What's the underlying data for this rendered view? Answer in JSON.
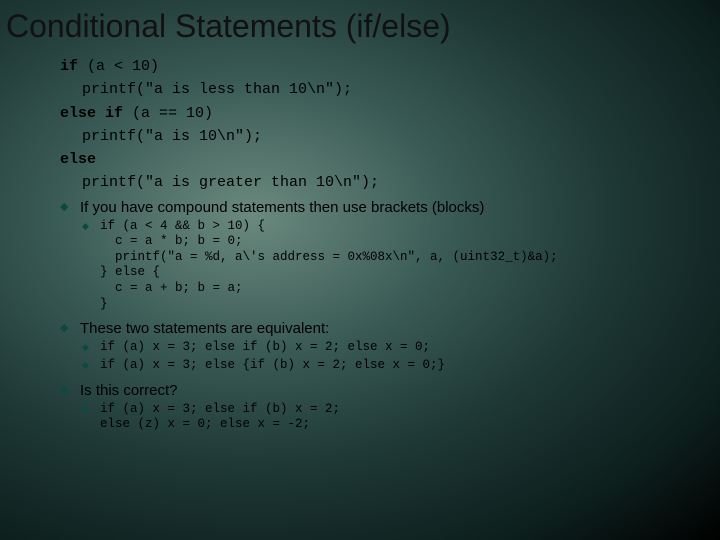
{
  "title": "Conditional Statements (if/else)",
  "code1": {
    "l1a": "if",
    "l1b": " (a < 10)",
    "l2": "printf(\"a is less than 10\\n\");",
    "l3a": "else if",
    "l3b": " (a == 10)",
    "l4": "printf(\"a is 10\\n\");",
    "l5": "else",
    "l6": "printf(\"a is greater than 10\\n\");"
  },
  "bullet1": "If you have compound statements then use brackets (blocks)",
  "block1": "if (a < 4 && b > 10) {\n  c = a * b; b = 0;\n  printf(\"a = %d, a\\'s address = 0x%08x\\n\", a, (uint32_t)&a);\n} else {\n  c = a + b; b = a;\n}",
  "bullet2": "These two statements are equivalent:",
  "equiv1": "if (a) x = 3; else if (b) x = 2; else x = 0;",
  "equiv2": "if (a) x = 3; else {if (b) x = 2; else x = 0;}",
  "bullet3": "Is this correct?",
  "q1": "if (a) x = 3; else if (b) x = 2;\nelse (z) x = 0; else x = -2;"
}
